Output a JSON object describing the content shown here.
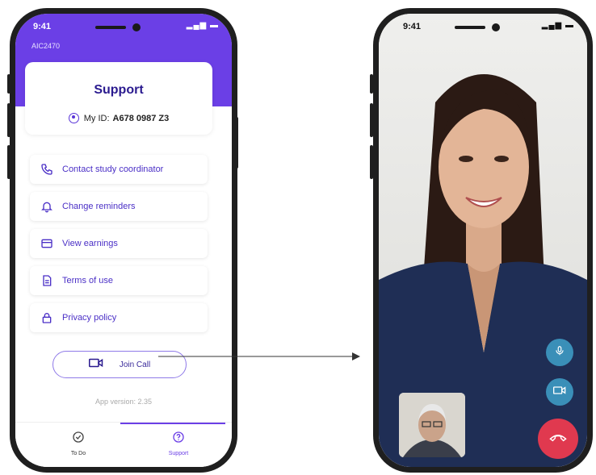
{
  "left_phone": {
    "status_time": "9:41",
    "study_id": "AIC2470",
    "title": "Support",
    "my_id_label": "My ID:",
    "my_id_value": "A678 0987 Z3",
    "menu_items": [
      {
        "label": "Contact study coordinator",
        "icon": "phone-icon"
      },
      {
        "label": "Change reminders",
        "icon": "bell-icon"
      },
      {
        "label": "View earnings",
        "icon": "credit-card-icon"
      },
      {
        "label": "Terms of use",
        "icon": "document-icon"
      },
      {
        "label": "Privacy policy",
        "icon": "lock-icon"
      }
    ],
    "join_call_label": "Join Call",
    "app_version": "App version: 2.35",
    "tabs": [
      {
        "label": "To Do",
        "icon": "check-circle-icon",
        "active": false
      },
      {
        "label": "Support",
        "icon": "help-circle-icon",
        "active": true
      }
    ]
  },
  "right_phone": {
    "status_time": "9:41",
    "controls": [
      {
        "name": "microphone",
        "icon": "microphone-icon",
        "color": "#3a8fb8"
      },
      {
        "name": "camera",
        "icon": "video-camera-icon",
        "color": "#3a8fb8"
      },
      {
        "name": "end-call",
        "icon": "end-call-icon",
        "color": "#e0394f"
      }
    ]
  },
  "colors": {
    "brand_purple": "#6b3fe6",
    "text_purple": "#4a2fc6",
    "control_blue": "#3a8fb8",
    "end_call_red": "#e0394f"
  }
}
